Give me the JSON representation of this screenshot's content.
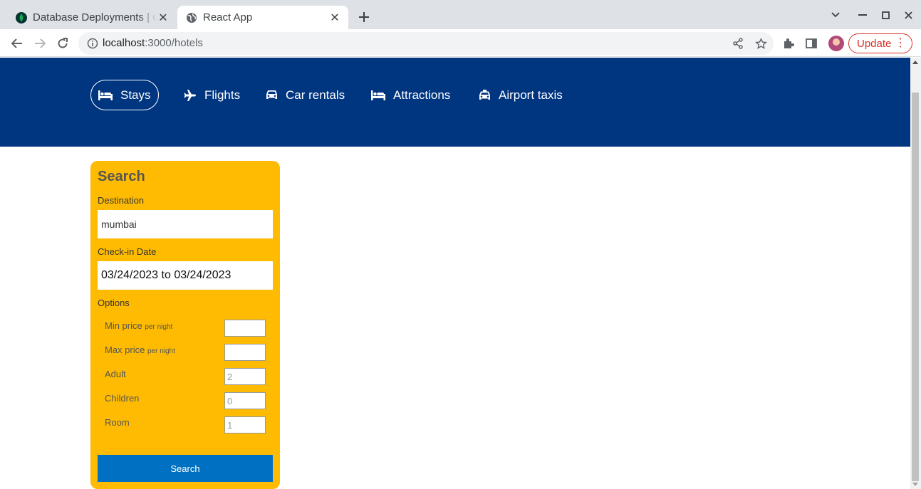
{
  "browser": {
    "tabs": [
      {
        "title": "Database Deployments | Cloud: MongoDB Cloud",
        "icon": "mongodb-leaf-icon",
        "active": false
      },
      {
        "title": "React App",
        "icon": "globe-icon",
        "active": true
      }
    ],
    "url": {
      "host": "localhost",
      "rest": ":3000/hotels"
    },
    "update_label": "Update"
  },
  "header": {
    "nav": [
      {
        "label": "Stays",
        "icon": "bed-icon",
        "active": true
      },
      {
        "label": "Flights",
        "icon": "plane-icon",
        "active": false
      },
      {
        "label": "Car rentals",
        "icon": "car-icon",
        "active": false
      },
      {
        "label": "Attractions",
        "icon": "bed-icon",
        "active": false
      },
      {
        "label": "Airport taxis",
        "icon": "taxi-icon",
        "active": false
      }
    ]
  },
  "search": {
    "title": "Search",
    "destination_label": "Destination",
    "destination_value": "mumbai",
    "checkin_label": "Check-in Date",
    "date_range": "03/24/2023 to 03/24/2023",
    "options_label": "Options",
    "options": [
      {
        "label": "Min price",
        "suffix": "per night",
        "value": "",
        "placeholder": ""
      },
      {
        "label": "Max price",
        "suffix": "per night",
        "value": "",
        "placeholder": ""
      },
      {
        "label": "Adult",
        "suffix": "",
        "value": "",
        "placeholder": "2"
      },
      {
        "label": "Children",
        "suffix": "",
        "value": "",
        "placeholder": "0"
      },
      {
        "label": "Room",
        "suffix": "",
        "value": "",
        "placeholder": "1"
      }
    ],
    "button_label": "Search"
  },
  "colors": {
    "header_bg": "#003580",
    "panel_bg": "#febb02",
    "button_bg": "#0071c2",
    "update_red": "#d93025"
  }
}
